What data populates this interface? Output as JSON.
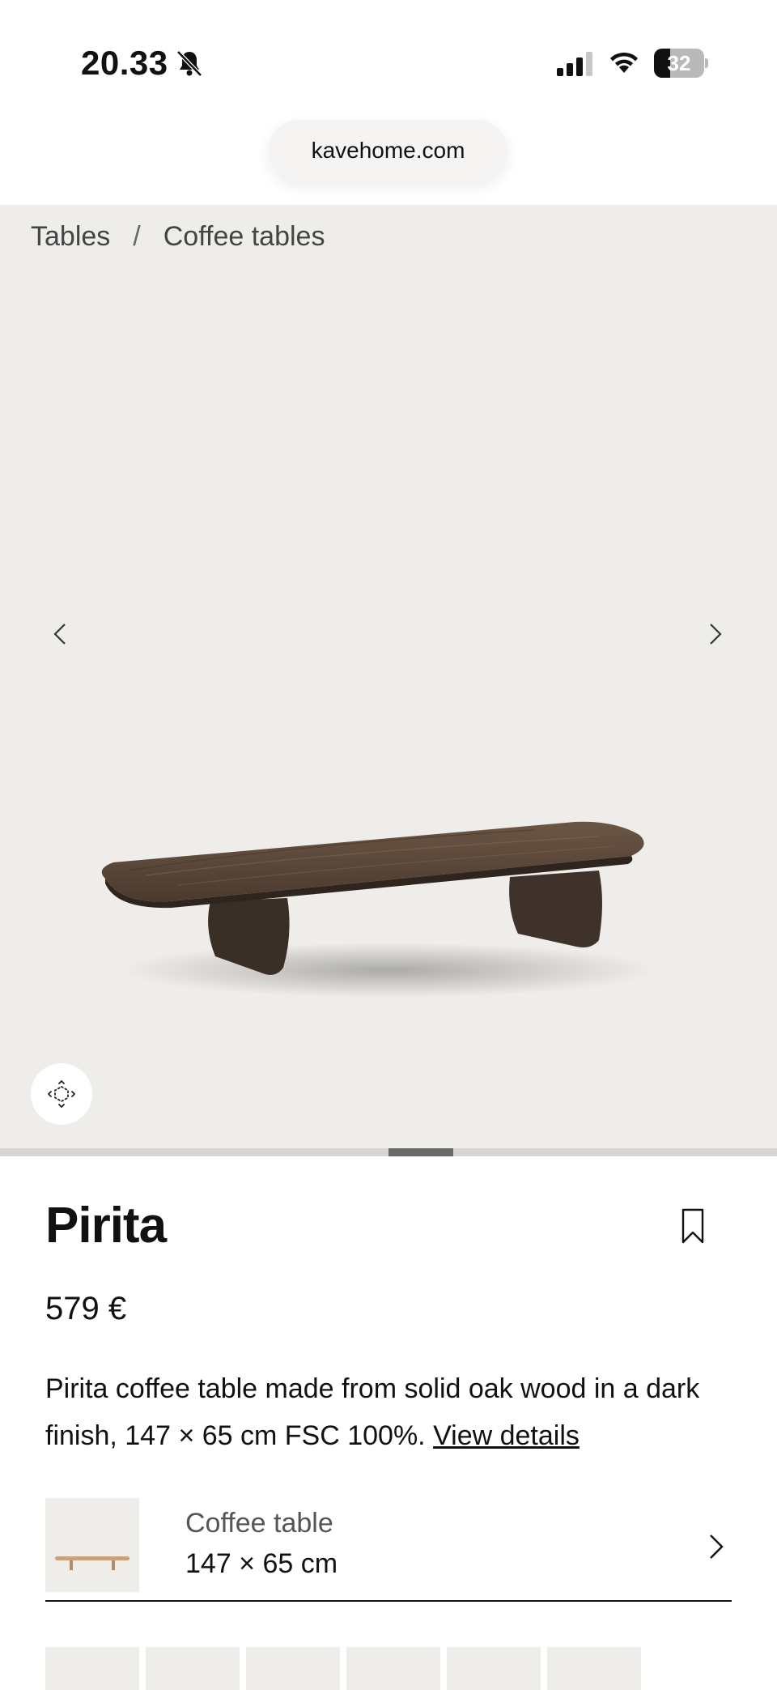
{
  "status_bar": {
    "time": "20.33",
    "battery_level": "32",
    "battery_fraction": 0.32
  },
  "browser": {
    "url": "kavehome.com"
  },
  "breadcrumb": {
    "items": [
      "Tables",
      "Coffee tables"
    ],
    "separator": "/"
  },
  "gallery": {
    "current_image": 7,
    "image_count": 12,
    "background_color": "#efedea",
    "wood_color": "#5a4636"
  },
  "product": {
    "name": "Pirita",
    "price": "579 €",
    "description": "Pirita coffee table made from solid oak wood in a dark finish, 147 × 65 cm FSC 100%.",
    "view_details_label": "View details"
  },
  "variant": {
    "type": "Coffee table",
    "size": "147 × 65 cm",
    "thumb_wood_color": "#c9a27a"
  },
  "icons": {
    "bell": "bell-slash-icon",
    "signal": "cellular-signal-icon",
    "wifi": "wifi-icon",
    "battery": "battery-icon",
    "prev": "chevron-left-icon",
    "next": "chevron-right-icon",
    "view3d": "3d-view-icon",
    "bookmark": "bookmark-icon",
    "variant_chevron": "chevron-right-icon"
  }
}
